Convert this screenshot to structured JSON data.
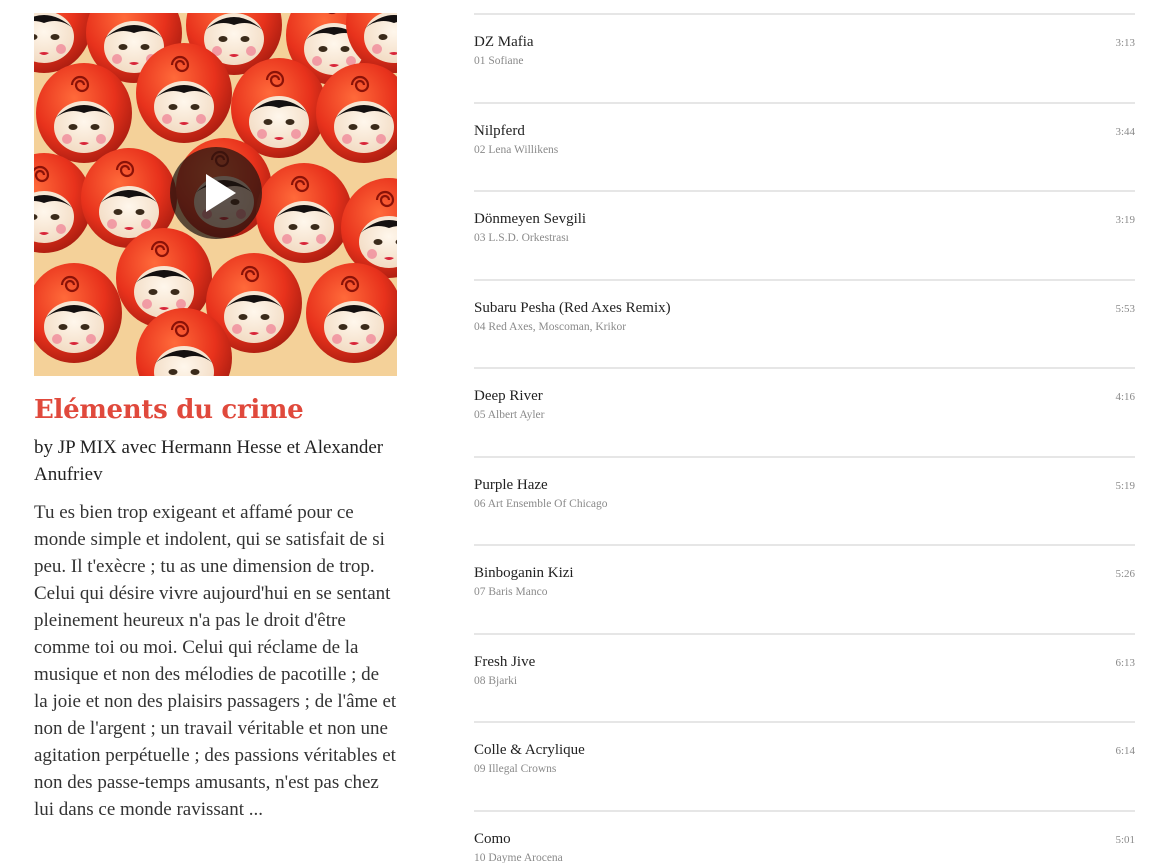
{
  "mix": {
    "title": "Eléments du crime",
    "byline": "by JP MIX avec Hermann Hesse et Alexander Anufriev",
    "description": "Tu es bien trop exigeant et affamé pour ce monde simple et indolent, qui se satisfait de si peu. Il t'exècre ; tu as une dimension de trop. Celui qui désire vivre aujourd'hui en se sentant pleinement heureux n'a pas le droit d'être comme toi ou moi. Celui qui réclame de la musique et non des mélodies de pacotille ; de la joie et non des plaisirs passagers ; de l'âme et non de l'argent ; un travail véritable et non une agitation perpétuelle ; des passions véritables et non des passe-temps amusants, n'est pas chez lui dans ce monde ravissant ...",
    "cover_icon": "matryoshka-dolls-image",
    "play_icon": "play-icon",
    "accent_color": "#e0493c"
  },
  "tracks": [
    {
      "title": "DZ Mafia",
      "artist": "01 Sofiane",
      "duration": "3:13"
    },
    {
      "title": "Nilpferd",
      "artist": "02 Lena Willikens",
      "duration": "3:44"
    },
    {
      "title": "Dönmeyen Sevgili",
      "artist": "03 L.S.D. Orkestrası",
      "duration": "3:19"
    },
    {
      "title": "Subaru Pesha (Red Axes Remix)",
      "artist": "04 Red Axes, Moscoman, Krikor",
      "duration": "5:53"
    },
    {
      "title": "Deep River",
      "artist": "05 Albert Ayler",
      "duration": "4:16"
    },
    {
      "title": "Purple Haze",
      "artist": "06 Art Ensemble Of Chicago",
      "duration": "5:19"
    },
    {
      "title": "Binboganin Kizi",
      "artist": "07 Baris Manco",
      "duration": "5:26"
    },
    {
      "title": "Fresh Jive",
      "artist": "08 Bjarki",
      "duration": "6:13"
    },
    {
      "title": "Colle & Acrylique",
      "artist": "09 Illegal Crowns",
      "duration": "6:14"
    },
    {
      "title": "Como",
      "artist": "10 Dayme Arocena",
      "duration": "5:01"
    }
  ]
}
